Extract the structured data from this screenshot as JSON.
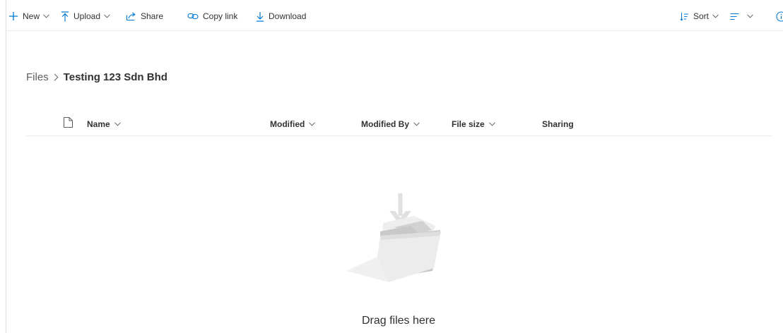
{
  "commands": {
    "new": {
      "label": "New",
      "icon": "plus-icon"
    },
    "upload": {
      "label": "Upload",
      "icon": "upload-icon"
    },
    "share": {
      "label": "Share",
      "icon": "share-icon"
    },
    "copy_link": {
      "label": "Copy link",
      "icon": "link-icon"
    },
    "download": {
      "label": "Download",
      "icon": "download-icon"
    },
    "sort": {
      "label": "Sort",
      "icon": "sort-icon"
    },
    "view": {
      "icon": "view-options-icon"
    },
    "info": {
      "icon": "info-icon"
    }
  },
  "breadcrumb": {
    "root": "Files",
    "current": "Testing 123 Sdn Bhd"
  },
  "columns": {
    "name": "Name",
    "modified": "Modified",
    "modified_by": "Modified By",
    "file_size": "File size",
    "sharing": "Sharing"
  },
  "empty_state": {
    "message": "Drag files here",
    "icon": "folder-drop-illustration"
  },
  "colors": {
    "accent": "#0078d4",
    "text": "#323130",
    "muted": "#605e5c",
    "divider": "#edebe9"
  }
}
